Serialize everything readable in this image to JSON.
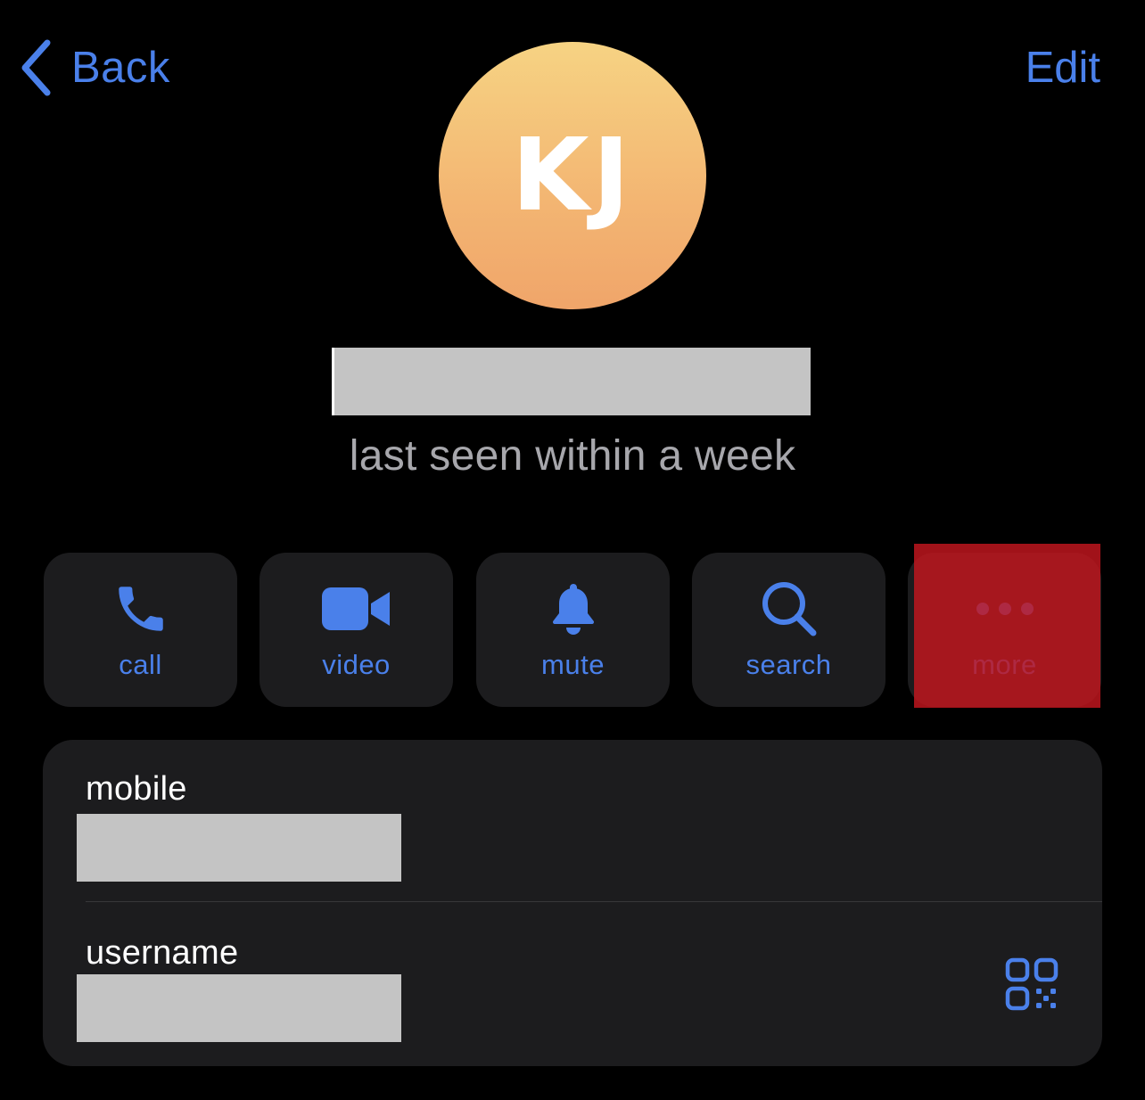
{
  "nav": {
    "back_label": "Back",
    "edit_label": "Edit"
  },
  "profile": {
    "initials": "KJ",
    "status": "last seen within a week",
    "avatar_gradient": [
      "#f6d383",
      "#f0a56a"
    ]
  },
  "actions": [
    {
      "label": "call",
      "icon": "phone-icon"
    },
    {
      "label": "video",
      "icon": "video-camera-icon"
    },
    {
      "label": "mute",
      "icon": "bell-icon"
    },
    {
      "label": "search",
      "icon": "magnifier-icon"
    },
    {
      "label": "more",
      "icon": "ellipsis-icon"
    }
  ],
  "info": {
    "mobile_label": "mobile",
    "username_label": "username",
    "qr_icon": "qr-code-icon"
  },
  "colors": {
    "accent": "#4a80ea",
    "background": "#000000",
    "card": "#1c1c1e",
    "secondary_text": "#a7a7ac",
    "redaction": "#c4c4c4",
    "highlight": "#c4161e"
  }
}
